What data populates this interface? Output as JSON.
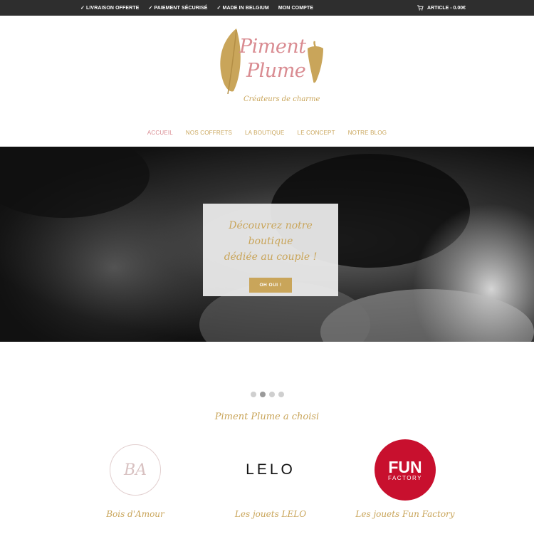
{
  "topbar": {
    "links": [
      "✓ LIVRAISON OFFERTE",
      "✓ PAIEMENT SÉCURISÉ",
      "✓ MADE IN BELGIUM",
      "MON COMPTE"
    ],
    "cart_label": "ARTICLE - 0.00€",
    "cart_icon": "cart-icon"
  },
  "logo": {
    "line1": "Piment",
    "line2": "Plume",
    "tagline": "Créateurs de charme",
    "colors": {
      "pink": "#d98b91",
      "gold": "#c9a55a"
    }
  },
  "nav": {
    "items": [
      "ACCUEIL",
      "NOS COFFRETS",
      "LA BOUTIQUE",
      "LE CONCEPT",
      "NOTRE BLOG"
    ],
    "active_index": 0
  },
  "hero": {
    "heading_line1": "Découvrez notre boutique",
    "heading_line2": "dédiée au couple !",
    "button_label": "OH OUI !",
    "accent_color": "#c9a55a"
  },
  "carousel": {
    "dot_count": 4,
    "active_dot": 2
  },
  "brands_section": {
    "title": "Piment Plume a choisi",
    "brands": [
      {
        "logo_text": "BA",
        "caption": "Bois d'Amour"
      },
      {
        "logo_text": "LELO",
        "caption": "Les jouets LELO"
      },
      {
        "logo_text_1": "FUN",
        "logo_text_2": "FACTORY",
        "caption": "Les jouets Fun Factory"
      }
    ]
  }
}
